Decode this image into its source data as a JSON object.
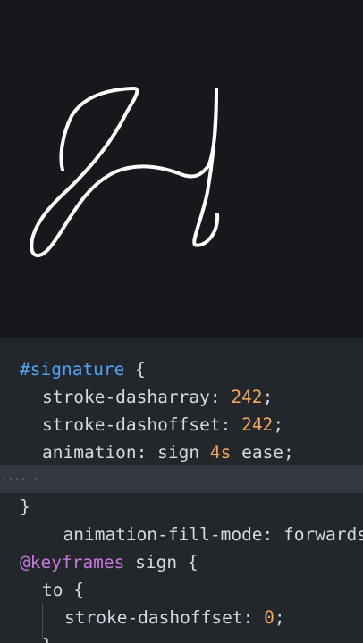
{
  "preview": {
    "signature_stroke_color": "#ffffff",
    "background_color": "#16181b"
  },
  "editor": {
    "background_color": "#23272c",
    "lines": [
      {
        "tokens": [
          {
            "t": "#signature",
            "c": "sel"
          },
          {
            "t": " {",
            "c": "plain"
          }
        ]
      },
      {
        "tokens": [
          {
            "t": "stroke-dasharray",
            "c": "prop"
          },
          {
            "t": ": ",
            "c": "plain"
          },
          {
            "t": "242",
            "c": "num"
          },
          {
            "t": ";",
            "c": "plain"
          }
        ]
      },
      {
        "tokens": [
          {
            "t": "stroke-dashoffset",
            "c": "prop"
          },
          {
            "t": ": ",
            "c": "plain"
          },
          {
            "t": "242",
            "c": "num"
          },
          {
            "t": ";",
            "c": "plain"
          }
        ]
      },
      {
        "tokens": [
          {
            "t": "animation",
            "c": "prop"
          },
          {
            "t": ": sign ",
            "c": "plain"
          },
          {
            "t": "4s",
            "c": "num"
          },
          {
            "t": " ease;",
            "c": "plain"
          }
        ]
      },
      {
        "tokens": [
          {
            "t": "animation-fill-mode",
            "c": "prop"
          },
          {
            "t": ": forwards",
            "c": "plain"
          }
        ]
      },
      {
        "tokens": [
          {
            "t": "}",
            "c": "plain"
          }
        ]
      },
      {
        "tokens": []
      },
      {
        "tokens": [
          {
            "t": "@keyframes",
            "c": "at"
          },
          {
            "t": " sign {",
            "c": "plain"
          }
        ]
      },
      {
        "tokens": [
          {
            "t": "to {",
            "c": "plain"
          }
        ]
      },
      {
        "tokens": [
          {
            "t": "stroke-dashoffset",
            "c": "prop"
          },
          {
            "t": ": ",
            "c": "plain"
          },
          {
            "t": "0",
            "c": "num"
          },
          {
            "t": ";",
            "c": "plain"
          }
        ]
      },
      {
        "tokens": [
          {
            "t": "}",
            "c": "plain"
          }
        ]
      }
    ]
  }
}
